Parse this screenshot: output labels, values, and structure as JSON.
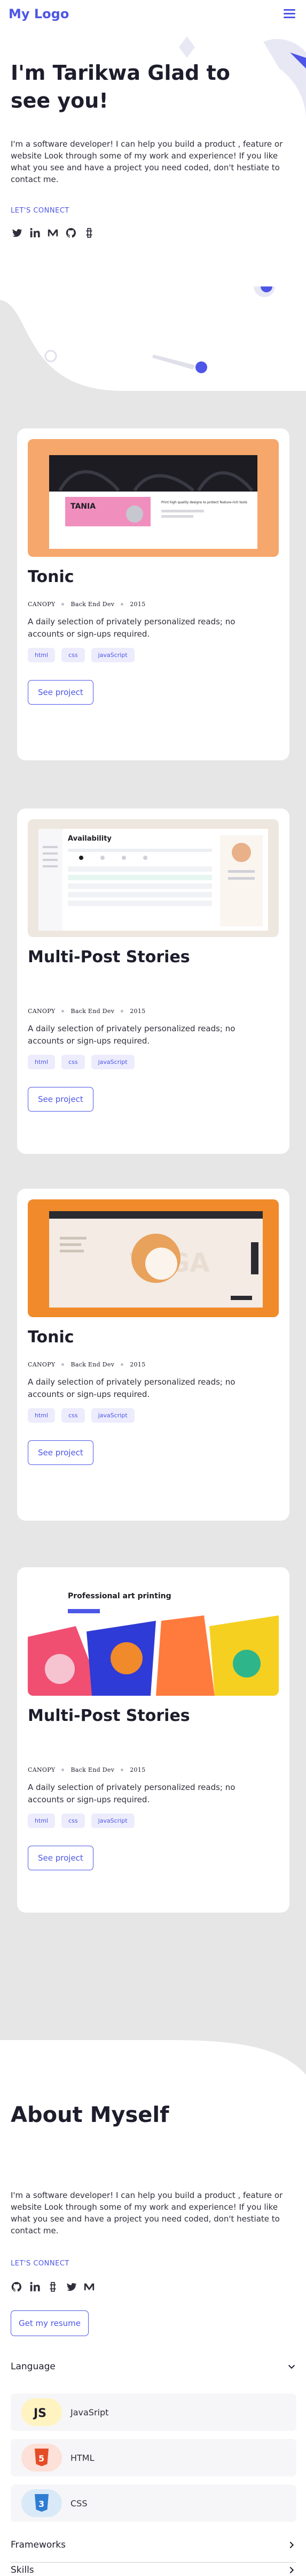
{
  "header": {
    "logo": "My Logo",
    "menu_icon": "hamburger-menu-icon"
  },
  "hero": {
    "title": "I'm Tarikwa Glad to see you!",
    "intro": "I'm a software developer! I can help you build a product , feature or website Look through some of my work and experience! If you like what you see and have a project you need coded, don't hestiate to contact me.",
    "connect_label": "LET'S CONNECT",
    "socials": [
      "twitter-icon",
      "linkedin-icon",
      "medium-icon",
      "github-icon",
      "hashnode-icon"
    ]
  },
  "projects": [
    {
      "title": "Tonic",
      "meta": [
        "CANOPY",
        "Back End Dev",
        "2015"
      ],
      "description": "A daily selection of privately personalized reads; no accounts or sign-ups required.",
      "tags": [
        "html",
        "css",
        "javaScript"
      ],
      "button": "See project",
      "screenshot_words": [
        "TANIA",
        "Print high quality designs to protect feature-rich tools"
      ]
    },
    {
      "title": "Multi-Post Stories",
      "meta": [
        "CANOPY",
        "Back End Dev",
        "2015"
      ],
      "description": "A daily selection of privately personalized reads; no accounts or sign-ups required.",
      "tags": [
        "html",
        "css",
        "javaScript"
      ],
      "button": "See project",
      "screenshot_words": [
        "Availability"
      ]
    },
    {
      "title": "Tonic",
      "meta": [
        "CANOPY",
        "Back End Dev",
        "2015"
      ],
      "description": "A daily selection of privately personalized reads; no accounts or sign-ups required.",
      "tags": [
        "html",
        "css",
        "javaScript"
      ],
      "button": "See project",
      "screenshot_words": [
        "YOGA"
      ]
    },
    {
      "title": "Multi-Post Stories",
      "meta": [
        "CANOPY",
        "Back End Dev",
        "2015"
      ],
      "description": "A daily selection of privately personalized reads; no accounts or sign-ups required.",
      "tags": [
        "html",
        "css",
        "javaScript"
      ],
      "button": "See project",
      "screenshot_words": [
        "Professional art printing"
      ]
    }
  ],
  "about": {
    "title": "About Myself",
    "intro": "I'm a software developer! I can help you build a product , feature or website Look through some of my work and experience! If you like what you see and have a project you need coded, don't hestiate to contact me.",
    "connect_label": "LET'S CONNECT",
    "socials": [
      "github-icon",
      "linkedin-icon",
      "hashnode-icon",
      "twitter-icon",
      "medium-icon"
    ],
    "resume_button": "Get my resume",
    "sections": [
      {
        "label": "Language",
        "expanded": true,
        "items": [
          {
            "label": "JavaSript",
            "badge": "JS",
            "color": "#f7df1e"
          },
          {
            "label": "HTML",
            "badge": "5",
            "color": "#e44d26"
          },
          {
            "label": "CSS",
            "badge": "3",
            "color": "#2f7cd3"
          }
        ]
      },
      {
        "label": "Frameworks",
        "expanded": false
      },
      {
        "label": "Skills",
        "expanded": false
      }
    ]
  },
  "colors": {
    "accent": "#4d56e6",
    "text": "#1d1d2c",
    "section_bg": "#e6e6e6",
    "tag_bg": "#ececfd"
  }
}
